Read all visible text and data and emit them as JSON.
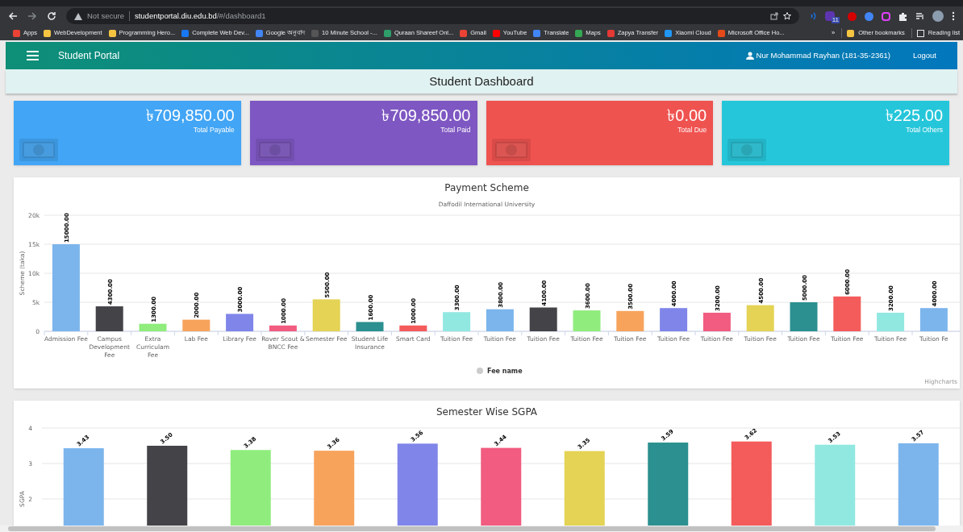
{
  "browser": {
    "security": "Not secure",
    "url_host": "studentportal.diu.edu.bd",
    "url_path": "/#/dashboard1",
    "bookmarks": [
      {
        "label": "Apps",
        "color": "#ea4335"
      },
      {
        "label": "WebDevelopment",
        "color": "#f5c542"
      },
      {
        "label": "Programming Hero...",
        "color": "#f5c542"
      },
      {
        "label": "Complete Web Dev...",
        "color": "#1877f2"
      },
      {
        "label": "Google অনুবাদ",
        "color": "#4285f4"
      },
      {
        "label": "10 Minute School -...",
        "color": "#555555"
      },
      {
        "label": "Quraan Shareef Onl...",
        "color": "#2e9e6b"
      },
      {
        "label": "Gmail",
        "color": "#ea4335"
      },
      {
        "label": "YouTube",
        "color": "#ff0000"
      },
      {
        "label": "Translate",
        "color": "#4285f4"
      },
      {
        "label": "Maps",
        "color": "#34a853"
      },
      {
        "label": "Zapya Transfer",
        "color": "#e53935"
      },
      {
        "label": "Xiaomi Cloud",
        "color": "#2196f3"
      },
      {
        "label": "Microsoft Office Ho...",
        "color": "#e64a19"
      }
    ],
    "overflow": "»",
    "other_bookmarks": "Other bookmarks",
    "reading_list": "Reading list",
    "extension_badge": "11"
  },
  "navbar": {
    "title": "Student Portal",
    "user": "Nur Mohammad Rayhan (181-35-2361)",
    "logout": "Logout"
  },
  "page_title": "Student Dashboard",
  "cards": [
    {
      "amount": "৳709,850.00",
      "label": "Total Payable",
      "color": "#42a5f5"
    },
    {
      "amount": "৳709,850.00",
      "label": "Total Paid",
      "color": "#7e57c2"
    },
    {
      "amount": "৳0.00",
      "label": "Total Due",
      "color": "#ef5350"
    },
    {
      "amount": "৳225.00",
      "label": "Total Others",
      "color": "#26c6da"
    }
  ],
  "payment_panel": {
    "subtitle": "Daffodil International University",
    "credit": "Highcharts",
    "chart_data": {
      "type": "bar",
      "title": "Payment Scheme",
      "ylabel": "Scheme (taka)",
      "grid": true,
      "categories": [
        "Admission Fee",
        "Campus Development Fee",
        "Extra Curriculam Fee",
        "Lab Fee",
        "Library Fee",
        "Rover Scout & BNCC Fee",
        "Semester Fee",
        "Student Life Insurance",
        "Smart Card",
        "Tuition Fee",
        "Tuition Fee",
        "Tuition Fee",
        "Tuition Fee",
        "Tuition Fee",
        "Tuition Fee",
        "Tuition Fee",
        "Tuition Fee",
        "Tuition Fee",
        "Tuition Fee",
        "Tuition Fee",
        "Tuition Fe"
      ],
      "series": [
        {
          "name": "Fee name",
          "colors": [
            "#7cb5ec",
            "#434348",
            "#90ed7d",
            "#f7a35c",
            "#8085e9",
            "#f15c80",
            "#e4d354",
            "#2b908f",
            "#f45b5b",
            "#91e8e1",
            "#7cb5ec",
            "#434348",
            "#90ed7d",
            "#f7a35c",
            "#8085e9",
            "#f15c80",
            "#e4d354",
            "#2b908f",
            "#f45b5b",
            "#91e8e1",
            "#7cb5ec"
          ],
          "values": [
            15000,
            4300,
            1300,
            2000,
            3000,
            1000,
            5500,
            1600,
            1000,
            3300,
            3800,
            4100,
            3600,
            3500,
            4000,
            3200,
            4500,
            5000,
            6000,
            3200,
            4000
          ]
        }
      ],
      "ylim": [
        0,
        20000
      ],
      "yticks": [
        0,
        {
          "value": 5000,
          "label": "5k"
        },
        {
          "value": 10000,
          "label": "10k"
        },
        {
          "value": 15000,
          "label": "15k"
        },
        {
          "value": 20000,
          "label": "20k"
        }
      ],
      "value_labels": [
        "15000.00",
        "4300.00",
        "1300.00",
        "2000.00",
        "3000.00",
        "1000.00",
        "5500.00",
        "1600.00",
        "1000.00",
        "3300.00",
        "3800.00",
        "4100.00",
        "3600.00",
        "3500.00",
        "4000.00",
        "3200.00",
        "4500.00",
        "5000.00",
        "6000.00",
        "3200.00",
        "4000.00"
      ]
    }
  },
  "sgpa_panel": {
    "chart_data": {
      "type": "bar",
      "title": "Semester Wise SGPA",
      "ylabel": "SGPA",
      "grid": true,
      "series": [
        {
          "colors": [
            "#7cb5ec",
            "#434348",
            "#90ed7d",
            "#f7a35c",
            "#8085e9",
            "#f15c80",
            "#e4d354",
            "#2b908f",
            "#f45b5b",
            "#91e8e1",
            "#7cb5ec"
          ],
          "values": [
            3.43,
            3.5,
            3.38,
            3.36,
            3.56,
            3.44,
            3.35,
            3.59,
            3.62,
            3.53,
            3.57
          ]
        }
      ],
      "ylim": [
        0,
        4
      ],
      "yticks": [
        2,
        3,
        4
      ],
      "value_labels": [
        "3.43",
        "3.50",
        "3.38",
        "3.36",
        "3.56",
        "3.44",
        "3.35",
        "3.59",
        "3.62",
        "3.53",
        "3.57"
      ]
    }
  }
}
